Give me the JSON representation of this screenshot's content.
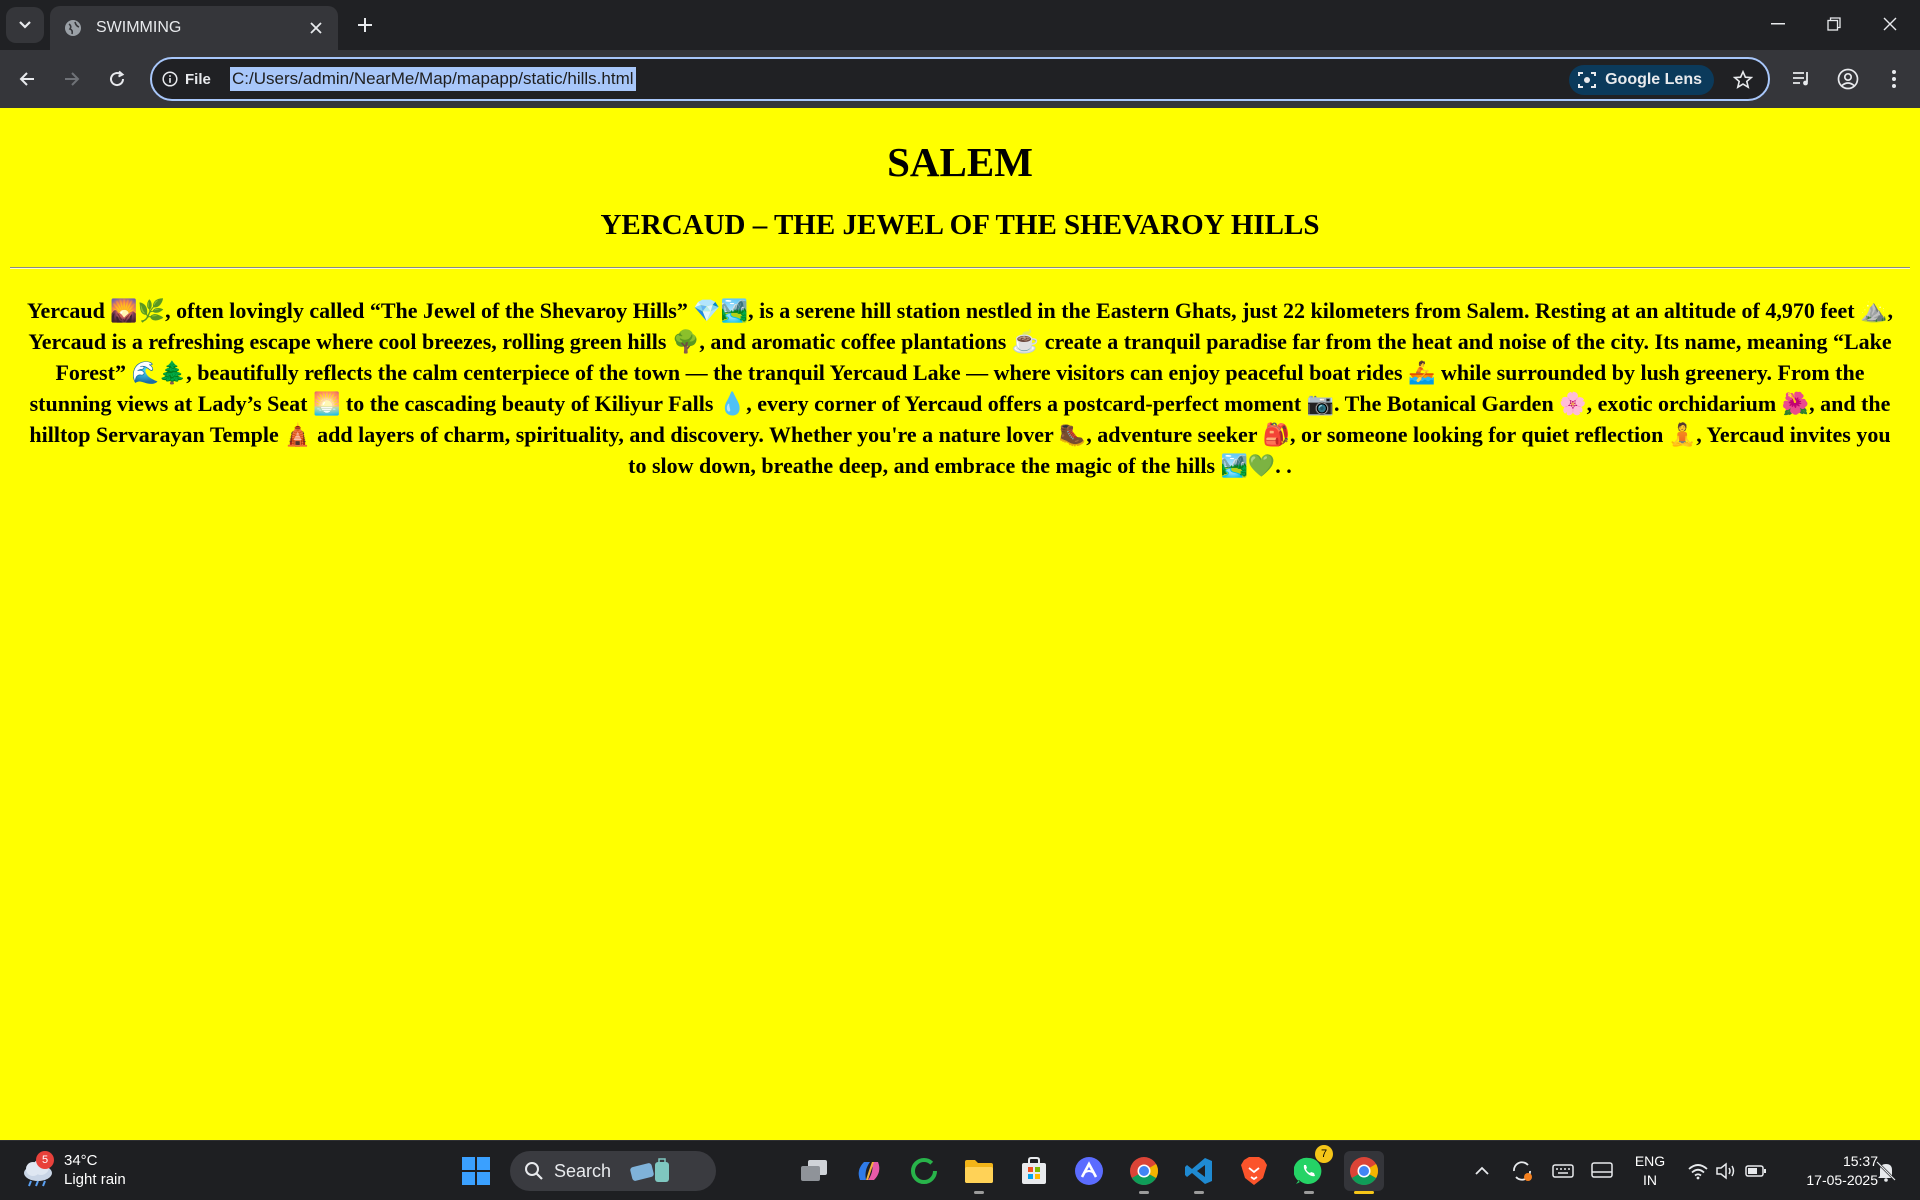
{
  "browser": {
    "tab_title": "SWIMMING",
    "site_chip_label": "File",
    "url": "C:/Users/admin/NearMe/Map/mapapp/static/hills.html",
    "lens_label": "Google Lens"
  },
  "page": {
    "heading": "SALEM",
    "subheading": "YERCAUD – THE JEWEL OF THE SHEVAROY HILLS",
    "paragraph": "Yercaud 🌄🌿, often lovingly called “The Jewel of the Shevaroy Hills” 💎🏞️, is a serene hill station nestled in the Eastern Ghats, just 22 kilometers from Salem. Resting at an altitude of 4,970 feet ⛰️, Yercaud is a refreshing escape where cool breezes, rolling green hills 🌳, and aromatic coffee plantations ☕ create a tranquil paradise far from the heat and noise of the city. Its name, meaning “Lake Forest” 🌊🌲, beautifully reflects the calm centerpiece of the town — the tranquil Yercaud Lake — where visitors can enjoy peaceful boat rides 🚣 while surrounded by lush greenery. From the stunning views at Lady’s Seat 🌅 to the cascading beauty of Kiliyur Falls 💧, every corner of Yercaud offers a postcard-perfect moment 📷. The Botanical Garden 🌸, exotic orchidarium 🌺, and the hilltop Servarayan Temple 🛕 add layers of charm, spirituality, and discovery. Whether you're a nature lover 🥾, adventure seeker 🎒, or someone looking for quiet reflection 🧘, Yercaud invites you to slow down, breathe deep, and embrace the magic of the hills 🏞️💚. ."
  },
  "taskbar": {
    "weather_badge": "5",
    "weather_temp": "34°C",
    "weather_desc": "Light rain",
    "search_label": "Search",
    "whatsapp_badge": "7",
    "language_line1": "ENG",
    "language_line2": "IN",
    "clock_time": "15:37",
    "clock_date": "17-05-2025"
  }
}
